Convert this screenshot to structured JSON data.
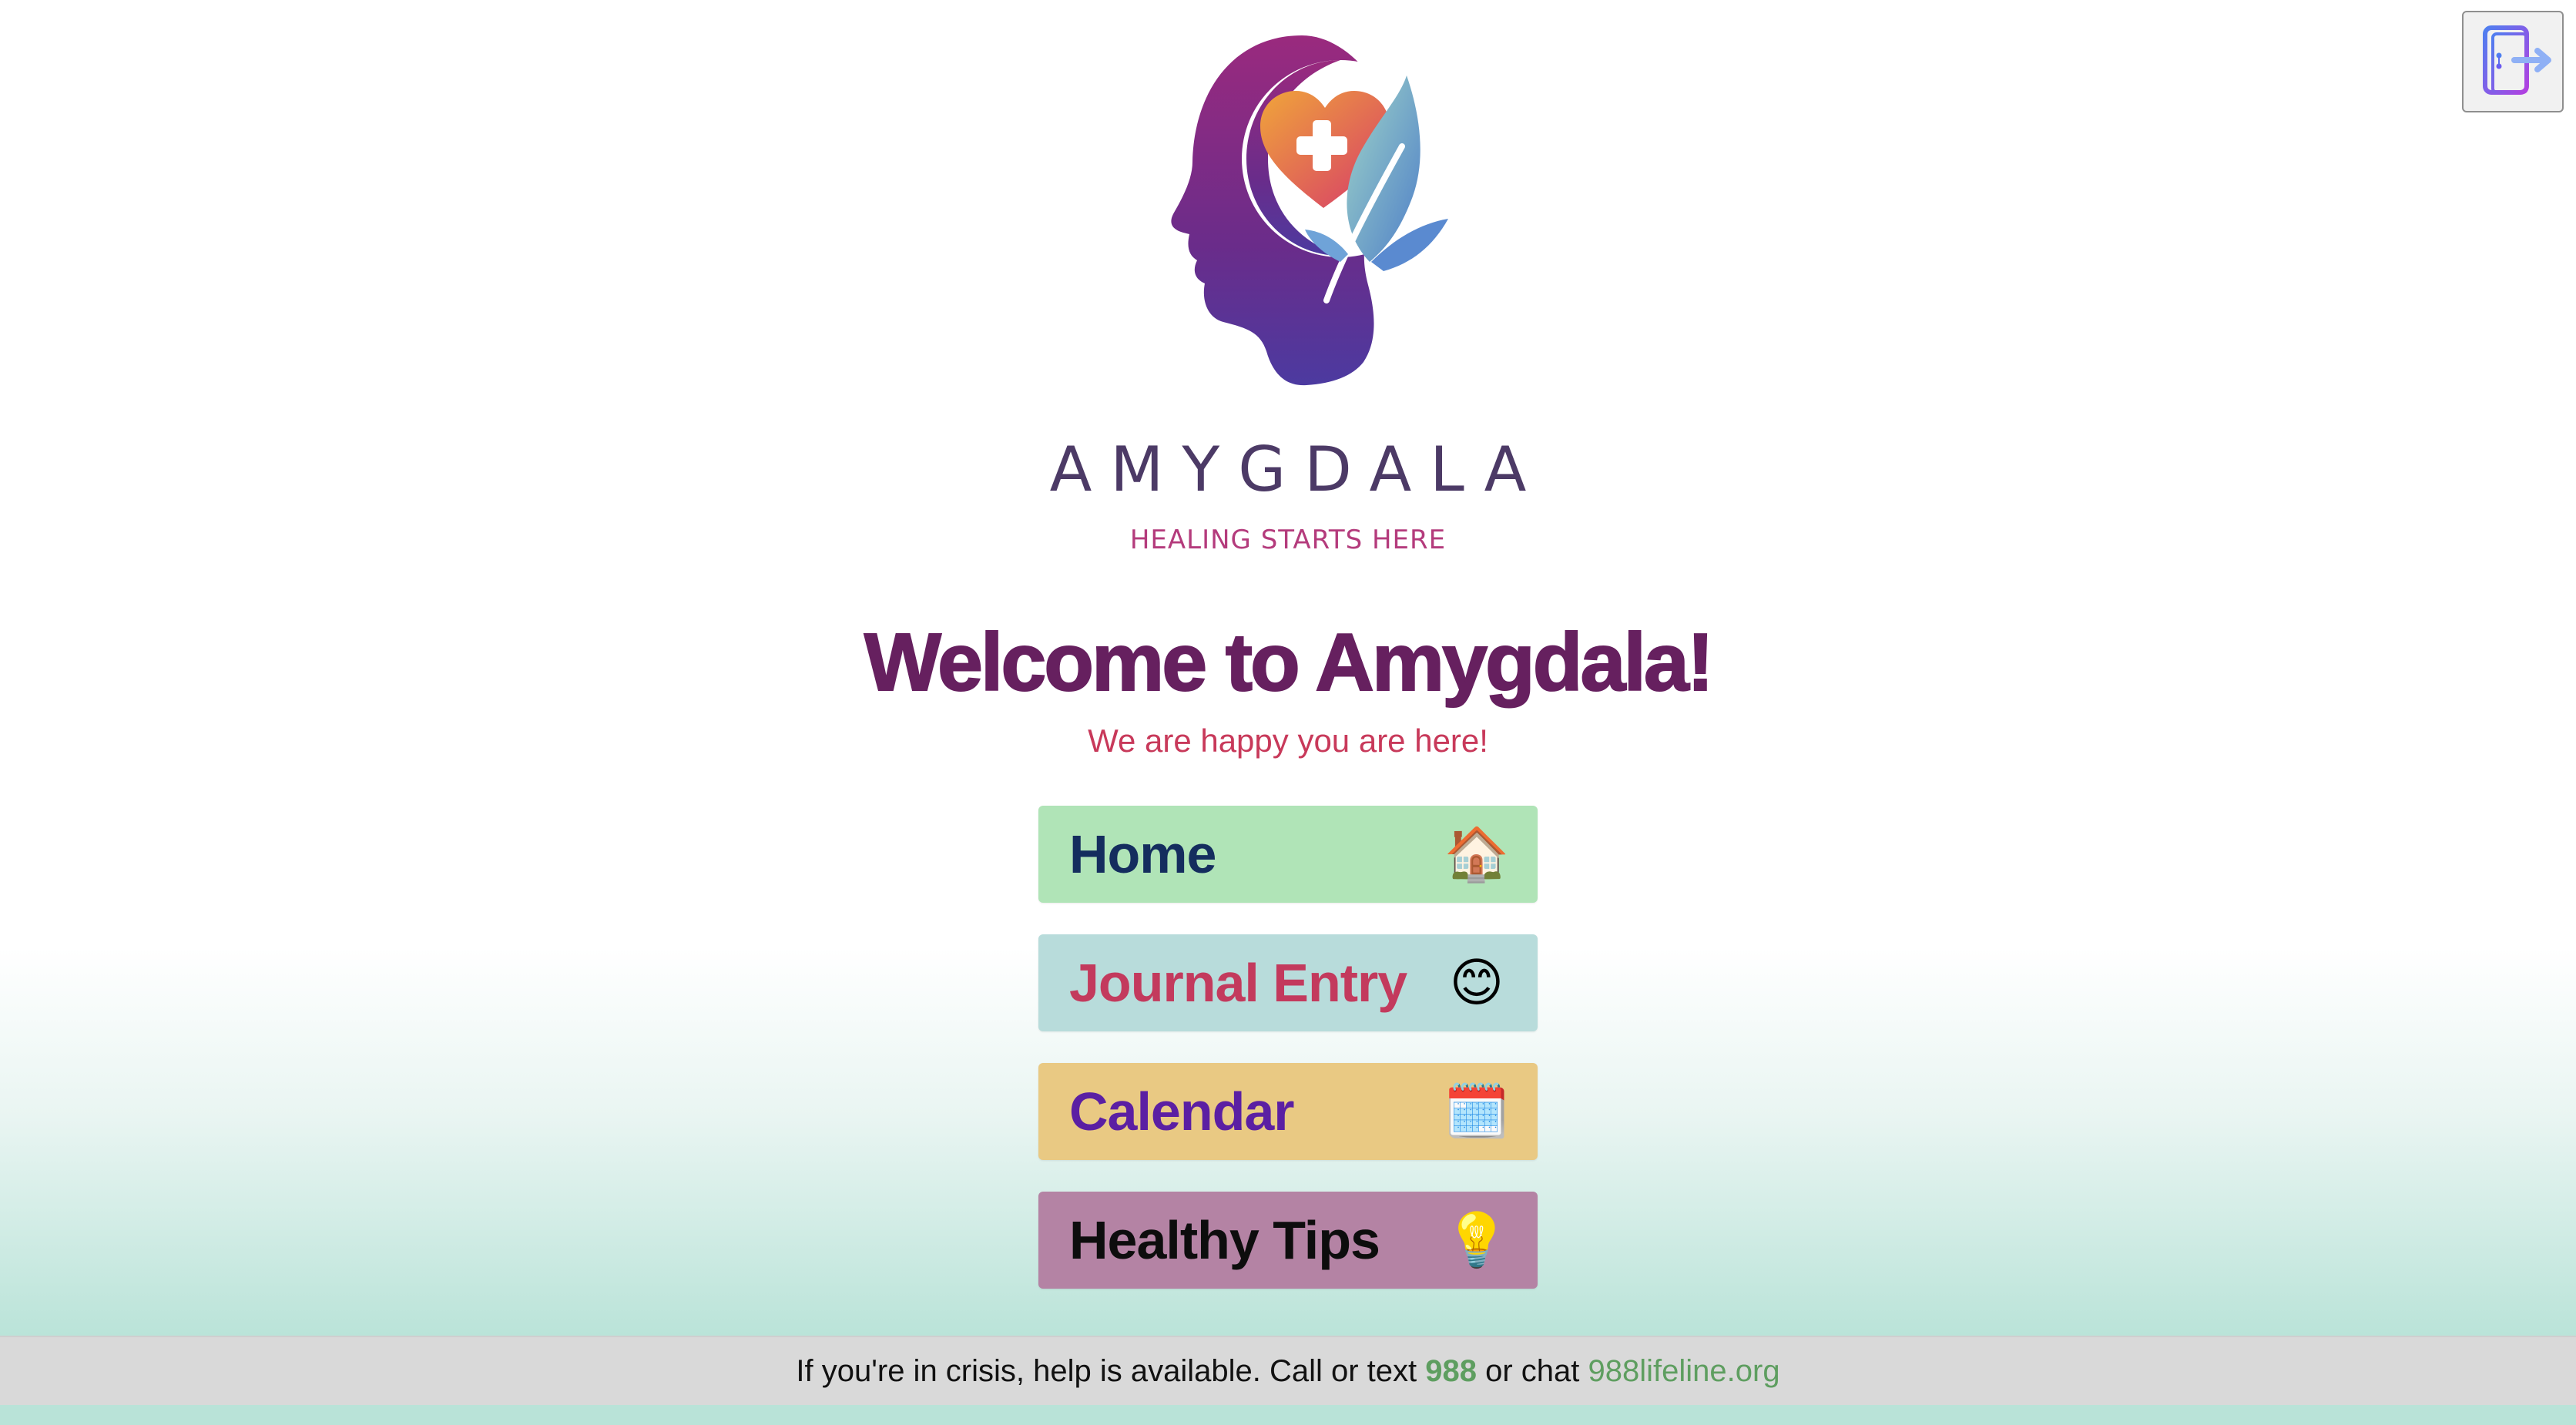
{
  "header": {
    "logout_button": {
      "icon": "logout-door-icon"
    }
  },
  "brand": {
    "name": "AMYGDALA",
    "tagline": "HEALING STARTS HERE",
    "logo_icon": "head-heart-leaf-logo"
  },
  "welcome": {
    "title": "Welcome to Amygdala!",
    "subtitle": "We are happy you are here!"
  },
  "nav": {
    "items": [
      {
        "label": "Home",
        "icon": "house-icon",
        "emoji": "🏠",
        "bg": "#b0e4b7",
        "color": "#142d5e"
      },
      {
        "label": "Journal Entry",
        "icon": "smiley-icon",
        "emoji": "😊",
        "bg": "#b8dcdb",
        "color": "#c33a5d"
      },
      {
        "label": "Calendar",
        "icon": "calendar-icon",
        "emoji": "🗓️",
        "bg": "#e9c983",
        "color": "#5b1fa3"
      },
      {
        "label": "Healthy Tips",
        "icon": "lightbulb-icon",
        "emoji": "💡",
        "bg": "#b483a4",
        "color": "#0d0d0d"
      }
    ]
  },
  "footer": {
    "text_before": "If you're in crisis, help is available. Call or text ",
    "number": "988",
    "text_middle": " or chat ",
    "link": "988lifeline.org"
  },
  "colors": {
    "brand_purple": "#66205f",
    "brand_pink": "#c8395a",
    "crisis_green": "#5e9e60"
  }
}
